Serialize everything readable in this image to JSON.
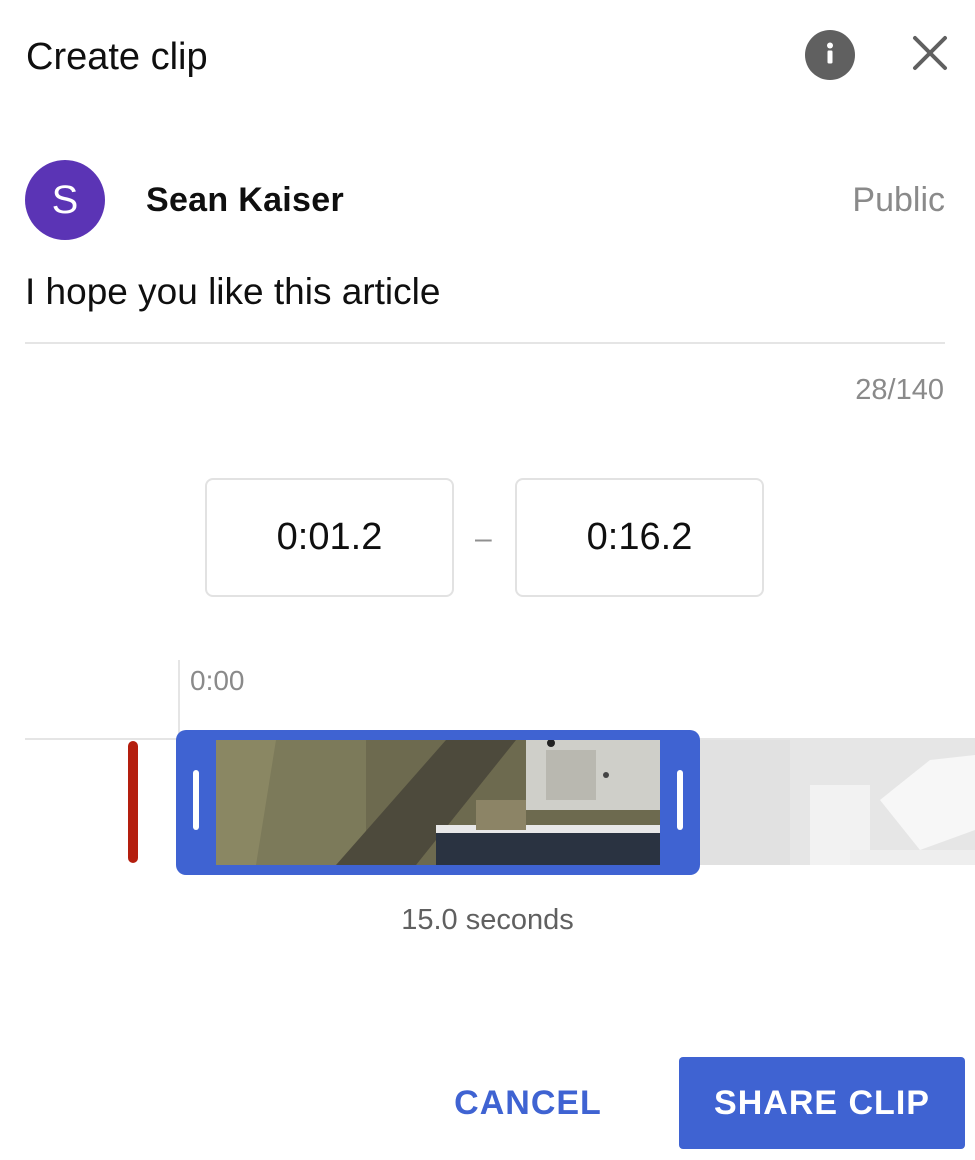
{
  "dialog": {
    "title": "Create clip",
    "info_icon": "info-icon",
    "close_icon": "close-icon"
  },
  "author": {
    "avatar_letter": "S",
    "avatar_color": "#5b34b5",
    "name": "Sean Kaiser",
    "visibility": "Public"
  },
  "clip_title": {
    "value": "I hope you like this article",
    "char_count": "28/140"
  },
  "time_range": {
    "start": "0:01.2",
    "separator": "–",
    "end": "0:16.2"
  },
  "timeline": {
    "start_label": "0:00",
    "playhead_color": "#b41e0e",
    "selection_color": "#3f63d2"
  },
  "duration_label": "15.0 seconds",
  "actions": {
    "cancel_label": "CANCEL",
    "share_label": "SHARE CLIP",
    "accent_color": "#3f63d2"
  }
}
